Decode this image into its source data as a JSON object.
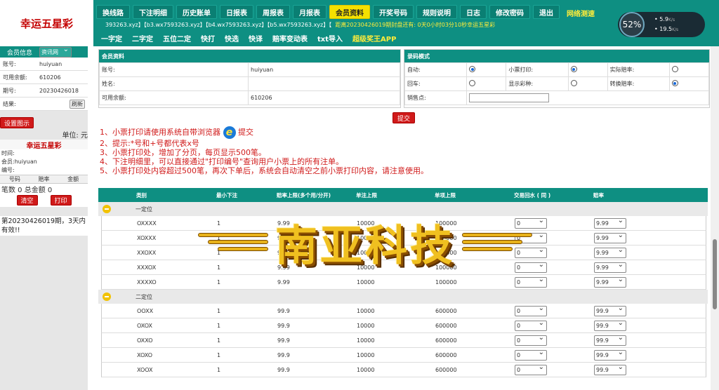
{
  "app": {
    "brand": "幸运五星彩"
  },
  "nav": [
    "换线路",
    "下注明细",
    "历史账单",
    "日报表",
    "周报表",
    "月报表",
    "会员资料",
    "开奖号码",
    "规则说明",
    "日志",
    "修改密码",
    "退出"
  ],
  "nav_active": "会员资料",
  "speedtest": "网络测速",
  "ticker": {
    "links": "393263.xyz】【b3.wx7593263.xyz】【b4.wx7593263.xyz】【b5.wx7593263.xyz】【",
    "countdown": "距离20230426019期封盘还有: 0天0小时03分10秒幸运五星彩"
  },
  "subnav": [
    "一字定",
    "二字定",
    "五位二定",
    "快打",
    "快选",
    "快译",
    "赔率变动表",
    "txt导入",
    "超级奖王APP"
  ],
  "gauge": {
    "percent": "52%",
    "up": "5.9",
    "down": "19.5",
    "unit": "K/s"
  },
  "left": {
    "tabs": [
      "会员信息",
      "资讯网"
    ],
    "info": [
      {
        "k": "账号:",
        "v": "huiyuan"
      },
      {
        "k": "可用余额:",
        "v": "610206"
      },
      {
        "k": "期号:",
        "v": "20230426018"
      },
      {
        "k": "结果:",
        "v": ""
      }
    ],
    "refresh": "刷新",
    "settings": "设置图示",
    "unit": "单位: 元",
    "panel_title": "幸运五星彩",
    "time": "时间:",
    "member": "会员:huiyuan",
    "code": "编号:",
    "grid_headers": [
      "号码",
      "赔率",
      "金额"
    ],
    "count": "笔数 0 总金额 0",
    "clear": "清空",
    "print": "打印",
    "notice": "第20230426019期，3天内有效!!"
  },
  "member_panel": {
    "title": "会员资料",
    "rows": [
      {
        "k": "账号:",
        "v": "huiyuan"
      },
      {
        "k": "姓名:",
        "v": ""
      },
      {
        "k": "可用余额:",
        "v": "610206"
      }
    ]
  },
  "record_panel": {
    "title": "录码模式",
    "rows": [
      [
        {
          "k": "自动:",
          "on": true
        },
        {
          "k": "小票打印:",
          "on": true
        },
        {
          "k": "实际赔率:",
          "on": false
        }
      ],
      [
        {
          "k": "回车:",
          "on": false
        },
        {
          "k": "显示彩种:",
          "on": false
        },
        {
          "k": "转换赔率:",
          "on": true
        }
      ]
    ],
    "sales": "销售点:"
  },
  "submit": "提交",
  "tips": [
    "1、小票打印请使用系统自带浏览器",
    "提交",
    "2、提示:*号和+号都代表x号",
    "3、小票打印处，增加了分页，每页显示500笔。",
    "4、下注明细里，可以直接通过\"打印编号\"查询用户小票上的所有注单。",
    "5、小票打印处内容超过500笔，再次下单后，系统会自动清空之前小票打印内容，请注意使用。"
  ],
  "grid": {
    "headers": [
      "类别",
      "最小下注",
      "赔率上限(多个用/分开)",
      "单注上限",
      "单项上限",
      "交易回水 ( 同 )",
      "赔率"
    ],
    "groups": [
      {
        "name": "一定位",
        "rows": [
          {
            "code": "OXXXX",
            "min": "1",
            "odds": "9.99",
            "single": "10000",
            "item": "100000",
            "rebate": "0",
            "rate": "9.99"
          },
          {
            "code": "XOXXX",
            "min": "1",
            "odds": "9.99",
            "single": "10000",
            "item": "100000",
            "rebate": "0",
            "rate": "9.99"
          },
          {
            "code": "XXOXX",
            "min": "1",
            "odds": "9.99",
            "single": "10000",
            "item": "100000",
            "rebate": "0",
            "rate": "9.99"
          },
          {
            "code": "XXXOX",
            "min": "1",
            "odds": "9.99",
            "single": "10000",
            "item": "100000",
            "rebate": "0",
            "rate": "9.99"
          },
          {
            "code": "XXXXO",
            "min": "1",
            "odds": "9.99",
            "single": "10000",
            "item": "100000",
            "rebate": "0",
            "rate": "9.99"
          }
        ]
      },
      {
        "name": "二定位",
        "rows": [
          {
            "code": "OOXX",
            "min": "1",
            "odds": "99.9",
            "single": "10000",
            "item": "600000",
            "rebate": "0",
            "rate": "99.9"
          },
          {
            "code": "OXOX",
            "min": "1",
            "odds": "99.9",
            "single": "10000",
            "item": "600000",
            "rebate": "0",
            "rate": "99.9"
          },
          {
            "code": "OXXO",
            "min": "1",
            "odds": "99.9",
            "single": "10000",
            "item": "600000",
            "rebate": "0",
            "rate": "99.9"
          },
          {
            "code": "XOXO",
            "min": "1",
            "odds": "99.9",
            "single": "10000",
            "item": "600000",
            "rebate": "0",
            "rate": "99.9"
          },
          {
            "code": "XOOX",
            "min": "1",
            "odds": "99.9",
            "single": "10000",
            "item": "600000",
            "rebate": "0",
            "rate": "99.9"
          }
        ]
      }
    ]
  },
  "watermark": "南亚科技"
}
